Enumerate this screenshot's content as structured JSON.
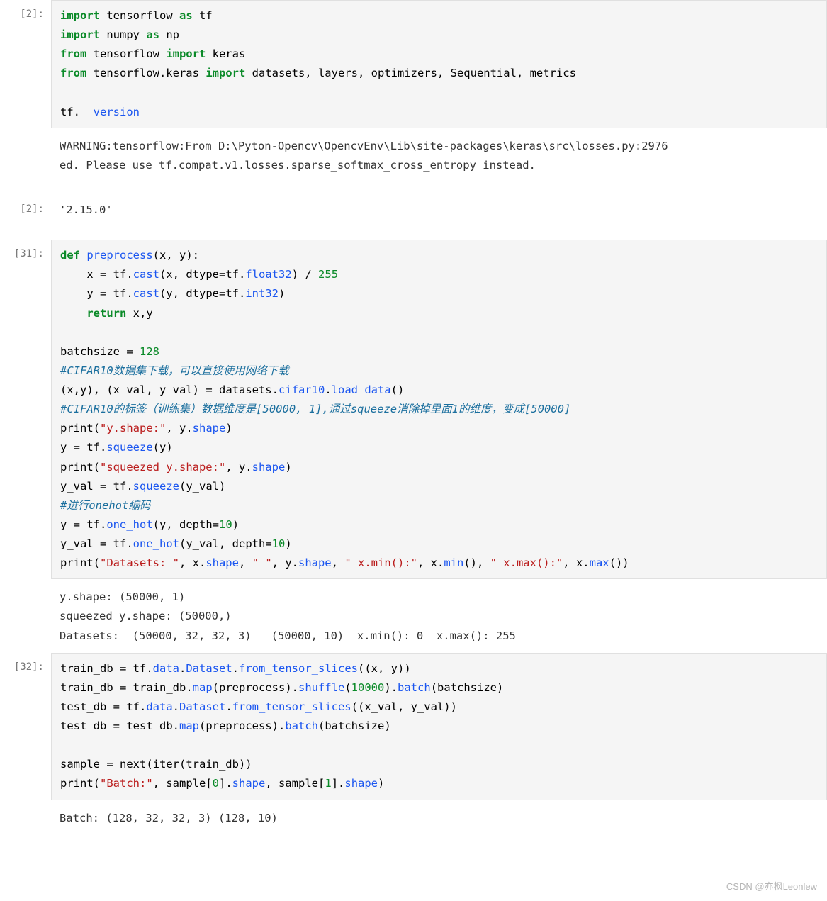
{
  "cells": {
    "c1": {
      "prompt": "[2]:",
      "code": {
        "l1": {
          "p1": "import",
          "p2": " tensorflow ",
          "p3": "as",
          "p4": " tf"
        },
        "l2": {
          "p1": "import",
          "p2": " numpy ",
          "p3": "as",
          "p4": " np"
        },
        "l3": {
          "p1": "from",
          "p2": " tensorflow ",
          "p3": "import",
          "p4": " keras"
        },
        "l4": {
          "p1": "from",
          "p2": " tensorflow.keras ",
          "p3": "import",
          "p4": " datasets, layers, optimizers, Sequential, metrics"
        },
        "l5": "",
        "l6": {
          "p1": "tf.",
          "p2": "__version__"
        }
      }
    },
    "c1_out": {
      "text": "WARNING:tensorflow:From D:\\Pyton-Opencv\\OpencvEnv\\Lib\\site-packages\\keras\\src\\losses.py:2976\ned. Please use tf.compat.v1.losses.sparse_softmax_cross_entropy instead."
    },
    "c1_result": {
      "prompt": "[2]:",
      "text": "'2.15.0'"
    },
    "c2": {
      "prompt": "[31]:",
      "code": {
        "l1": {
          "p1": "def",
          "p2": " ",
          "p3": "preprocess",
          "p4": "(x, y):"
        },
        "l2": {
          "p1": "    x ",
          "p2": "=",
          "p3": " tf.",
          "p4": "cast",
          "p5": "(x, dtype",
          "p6": "=",
          "p7": "tf.",
          "p8": "float32",
          "p9": ") ",
          "p10": "/",
          "p11": " ",
          "p12": "255"
        },
        "l3": {
          "p1": "    y ",
          "p2": "=",
          "p3": " tf.",
          "p4": "cast",
          "p5": "(y, dtype",
          "p6": "=",
          "p7": "tf.",
          "p8": "int32",
          "p9": ")"
        },
        "l4": {
          "p1": "    ",
          "p2": "return",
          "p3": " x,y"
        },
        "l5": "",
        "l6": {
          "p1": "batchsize ",
          "p2": "=",
          "p3": " ",
          "p4": "128"
        },
        "l7": {
          "c": "#CIFAR10数据集下载，可以直接使用网络下载"
        },
        "l8": {
          "p1": "(x,y), (x_val, y_val) ",
          "p2": "=",
          "p3": " datasets.",
          "p4": "cifar10",
          "p5": ".",
          "p6": "load_data",
          "p7": "()"
        },
        "l9": {
          "c": "#CIFAR10的标签（训练集）数据维度是[50000, 1],通过squeeze消除掉里面1的维度，变成[50000]"
        },
        "l10": {
          "p1": "print(",
          "p2": "\"y.shape:\"",
          "p3": ", y.",
          "p4": "shape",
          "p5": ")"
        },
        "l11": {
          "p1": "y ",
          "p2": "=",
          "p3": " tf.",
          "p4": "squeeze",
          "p5": "(y)"
        },
        "l12": {
          "p1": "print(",
          "p2": "\"squeezed y.shape:\"",
          "p3": ", y.",
          "p4": "shape",
          "p5": ")"
        },
        "l13": {
          "p1": "y_val ",
          "p2": "=",
          "p3": " tf.",
          "p4": "squeeze",
          "p5": "(y_val)"
        },
        "l14": {
          "c": "#进行onehot编码"
        },
        "l15": {
          "p1": "y ",
          "p2": "=",
          "p3": " tf.",
          "p4": "one_hot",
          "p5": "(y, depth",
          "p6": "=",
          "p7": "10",
          "p8": ")"
        },
        "l16": {
          "p1": "y_val ",
          "p2": "=",
          "p3": " tf.",
          "p4": "one_hot",
          "p5": "(y_val, depth",
          "p6": "=",
          "p7": "10",
          "p8": ")"
        },
        "l17": {
          "p1": "print(",
          "p2": "\"Datasets: \"",
          "p3": ", x.",
          "p4": "shape",
          "p5": ", ",
          "p6": "\" \"",
          "p7": ", y.",
          "p8": "shape",
          "p9": ", ",
          "p10": "\" x.min():\"",
          "p11": ", x.",
          "p12": "min",
          "p13": "(), ",
          "p14": "\" x.max():\"",
          "p15": ", x.",
          "p16": "max",
          "p17": "())"
        }
      }
    },
    "c2_out": {
      "text": "y.shape: (50000, 1)\nsqueezed y.shape: (50000,)\nDatasets:  (50000, 32, 32, 3)   (50000, 10)  x.min(): 0  x.max(): 255"
    },
    "c3": {
      "prompt": "[32]:",
      "code": {
        "l1": {
          "p1": "train_db ",
          "p2": "=",
          "p3": " tf.",
          "p4": "data",
          "p5": ".",
          "p6": "Dataset",
          "p7": ".",
          "p8": "from_tensor_slices",
          "p9": "((x, y))"
        },
        "l2": {
          "p1": "train_db ",
          "p2": "=",
          "p3": " train_db.",
          "p4": "map",
          "p5": "(preprocess).",
          "p6": "shuffle",
          "p7": "(",
          "p8": "10000",
          "p9": ").",
          "p10": "batch",
          "p11": "(batchsize)"
        },
        "l3": {
          "p1": "test_db ",
          "p2": "=",
          "p3": " tf.",
          "p4": "data",
          "p5": ".",
          "p6": "Dataset",
          "p7": ".",
          "p8": "from_tensor_slices",
          "p9": "((x_val, y_val))"
        },
        "l4": {
          "p1": "test_db ",
          "p2": "=",
          "p3": " test_db.",
          "p4": "map",
          "p5": "(preprocess).",
          "p6": "batch",
          "p7": "(batchsize)"
        },
        "l5": "",
        "l6": {
          "p1": "sample ",
          "p2": "=",
          "p3": " next(iter(train_db))"
        },
        "l7": {
          "p1": "print(",
          "p2": "\"Batch:\"",
          "p3": ", sample[",
          "p4": "0",
          "p5": "].",
          "p6": "shape",
          "p7": ", sample[",
          "p8": "1",
          "p9": "].",
          "p10": "shape",
          "p11": ")"
        }
      }
    },
    "c3_out": {
      "text": "Batch: (128, 32, 32, 3) (128, 10)"
    }
  },
  "watermark": "CSDN @亦枫Leonlew"
}
